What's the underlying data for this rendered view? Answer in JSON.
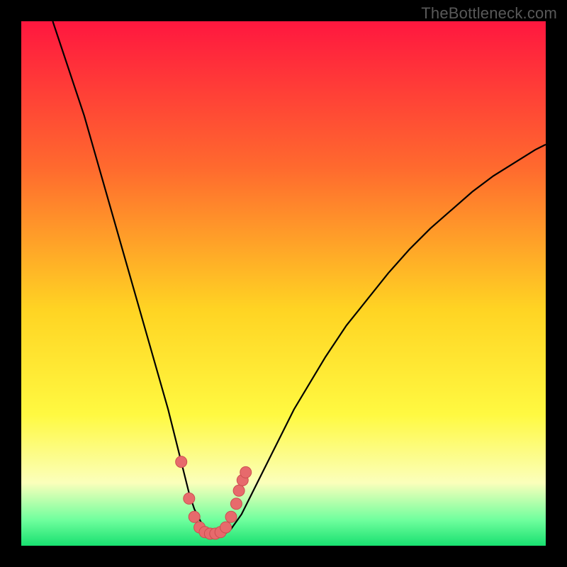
{
  "watermark": "TheBottleneck.com",
  "colors": {
    "frame": "#000000",
    "grad_top": "#ff173f",
    "grad_mid1": "#ff6a2e",
    "grad_mid2": "#ffd423",
    "grad_yellow": "#fff941",
    "grad_pale": "#fbffbb",
    "grad_mint": "#71ff9e",
    "grad_green": "#18e070",
    "curve": "#000000",
    "marker_fill": "#e76a6c",
    "marker_stroke": "#cc4e50"
  },
  "chart_data": {
    "type": "line",
    "title": "",
    "xlabel": "",
    "ylabel": "",
    "xlim": [
      0,
      100
    ],
    "ylim": [
      0,
      100
    ],
    "series": [
      {
        "name": "bottleneck-curve",
        "x": [
          6,
          8,
          10,
          12,
          14,
          16,
          18,
          20,
          22,
          24,
          26,
          28,
          29,
          30,
          31,
          32,
          33,
          34,
          35,
          36,
          37,
          38,
          39,
          40,
          42,
          44,
          46,
          48,
          50,
          52,
          55,
          58,
          62,
          66,
          70,
          74,
          78,
          82,
          86,
          90,
          94,
          98,
          100
        ],
        "y": [
          100,
          94,
          88,
          82,
          75,
          68,
          61,
          54,
          47,
          40,
          33,
          26,
          22,
          18,
          14,
          10,
          7,
          5,
          3.2,
          2.4,
          2.2,
          2.2,
          2.4,
          3.2,
          6,
          10,
          14,
          18,
          22,
          26,
          31,
          36,
          42,
          47,
          52,
          56.5,
          60.5,
          64,
          67.5,
          70.5,
          73,
          75.5,
          76.5
        ]
      }
    ],
    "markers": {
      "name": "highlight-points",
      "x": [
        30.5,
        32,
        33,
        34,
        35,
        36,
        37,
        38,
        39,
        40,
        41,
        41.5,
        42.2,
        42.8
      ],
      "y": [
        16,
        9,
        5.5,
        3.5,
        2.6,
        2.3,
        2.3,
        2.6,
        3.5,
        5.5,
        8,
        10.5,
        12.5,
        14
      ]
    }
  }
}
